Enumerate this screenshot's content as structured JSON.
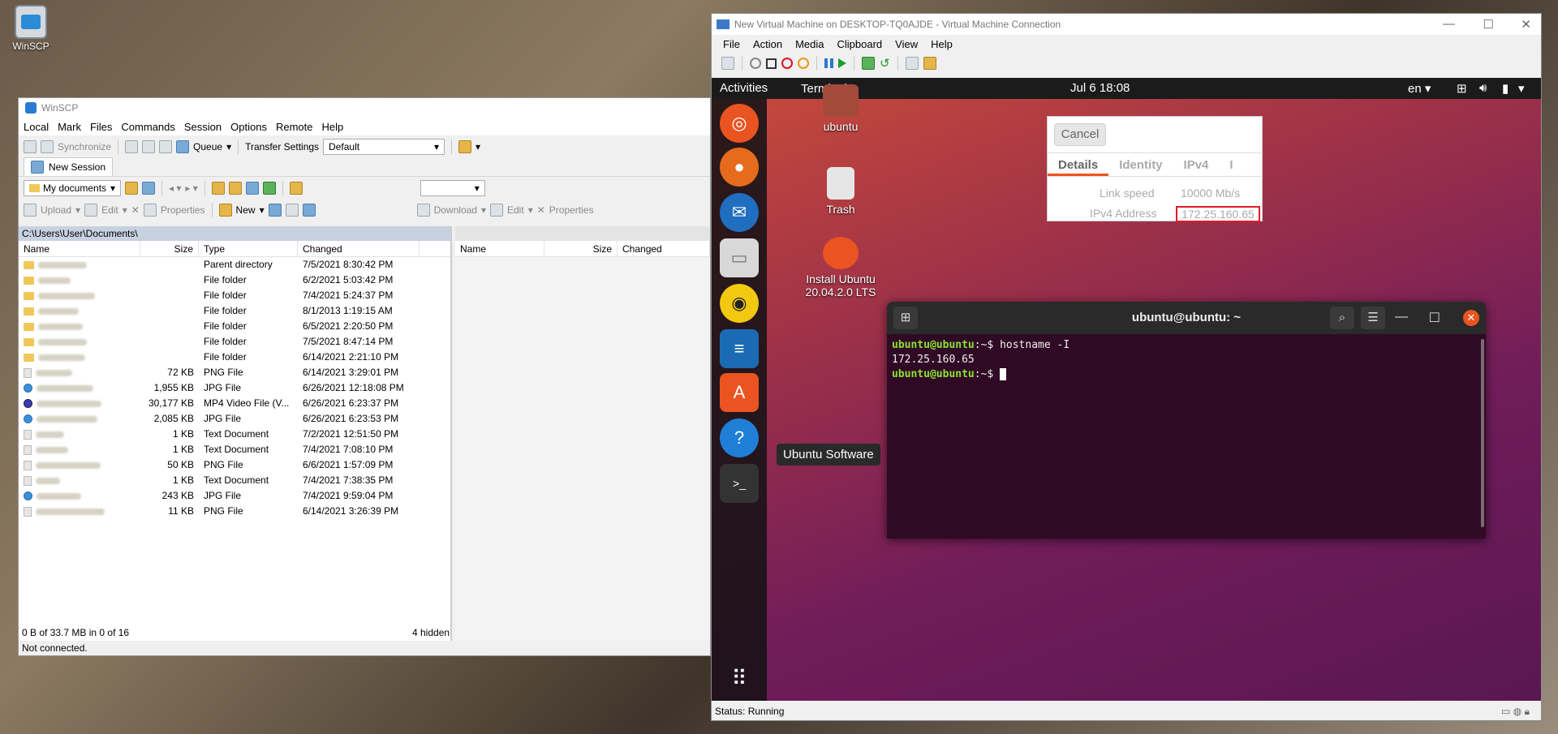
{
  "desktop": {
    "winscp_icon_label": "WinSCP"
  },
  "winscp": {
    "title": "WinSCP",
    "menu": [
      "Local",
      "Mark",
      "Files",
      "Commands",
      "Session",
      "Options",
      "Remote",
      "Help"
    ],
    "toolbar": {
      "synchronize": "Synchronize",
      "queue": "Queue",
      "transfer_settings": "Transfer Settings",
      "transfer_value": "Default"
    },
    "tab": "New Session",
    "left_location": "My documents",
    "left_actions": {
      "upload": "Upload",
      "edit": "Edit",
      "properties": "Properties",
      "new": "New"
    },
    "right_actions": {
      "download": "Download",
      "edit": "Edit",
      "properties": "Properties"
    },
    "left_path": "C:\\Users\\User\\Documents\\",
    "columns": {
      "name": "Name",
      "size": "Size",
      "type": "Type",
      "changed": "Changed"
    },
    "files": [
      {
        "size": "",
        "type": "Parent directory",
        "changed": "7/5/2021  8:30:42 PM",
        "icon": "folder"
      },
      {
        "size": "",
        "type": "File folder",
        "changed": "6/2/2021  5:03:42 PM",
        "icon": "folder"
      },
      {
        "size": "",
        "type": "File folder",
        "changed": "7/4/2021  5:24:37 PM",
        "icon": "folder"
      },
      {
        "size": "",
        "type": "File folder",
        "changed": "8/1/2013  1:19:15 AM",
        "icon": "folder"
      },
      {
        "size": "",
        "type": "File folder",
        "changed": "6/5/2021  2:20:50 PM",
        "icon": "folder"
      },
      {
        "size": "",
        "type": "File folder",
        "changed": "7/5/2021  8:47:14 PM",
        "icon": "folder"
      },
      {
        "size": "",
        "type": "File folder",
        "changed": "6/14/2021  2:21:10 PM",
        "icon": "folder"
      },
      {
        "size": "72 KB",
        "type": "PNG File",
        "changed": "6/14/2021  3:29:01 PM",
        "icon": "file"
      },
      {
        "size": "1,955 KB",
        "type": "JPG File",
        "changed": "6/26/2021  12:18:08 PM",
        "icon": "jpg"
      },
      {
        "size": "30,177 KB",
        "type": "MP4 Video File (V...",
        "changed": "6/26/2021  6:23:37 PM",
        "icon": "mp4"
      },
      {
        "size": "2,085 KB",
        "type": "JPG File",
        "changed": "6/26/2021  6:23:53 PM",
        "icon": "jpg"
      },
      {
        "size": "1 KB",
        "type": "Text Document",
        "changed": "7/2/2021  12:51:50 PM",
        "icon": "file"
      },
      {
        "size": "1 KB",
        "type": "Text Document",
        "changed": "7/4/2021  7:08:10 PM",
        "icon": "file"
      },
      {
        "size": "50 KB",
        "type": "PNG File",
        "changed": "6/6/2021  1:57:09 PM",
        "icon": "file"
      },
      {
        "size": "1 KB",
        "type": "Text Document",
        "changed": "7/4/2021  7:38:35 PM",
        "icon": "file"
      },
      {
        "size": "243 KB",
        "type": "JPG File",
        "changed": "7/4/2021  9:59:04 PM",
        "icon": "jpg"
      },
      {
        "size": "11 KB",
        "type": "PNG File",
        "changed": "6/14/2021  3:26:39 PM",
        "icon": "file"
      }
    ],
    "status_left": "0 B of 33.7 MB in 0 of 16",
    "status_hidden": "4 hidden",
    "connection": "Not connected."
  },
  "vm": {
    "title": "New Virtual Machine on DESKTOP-TQ0AJDE - Virtual Machine Connection",
    "menu": [
      "File",
      "Action",
      "Media",
      "Clipboard",
      "View",
      "Help"
    ],
    "status": "Status: Running"
  },
  "ubuntu": {
    "topbar": {
      "activities": "Activities",
      "app": "Terminal ▾",
      "clock": "Jul 6  18:08",
      "lang": "en ▾"
    },
    "desktop_icons": {
      "home": "ubuntu",
      "trash": "Trash",
      "install": "Install Ubuntu 20.04.2.0 LTS"
    },
    "dock_tooltip": "Ubuntu Software",
    "network": {
      "cancel": "Cancel",
      "tabs": [
        "Details",
        "Identity",
        "IPv4",
        "I"
      ],
      "link_speed_label": "Link speed",
      "link_speed": "10000 Mb/s",
      "ipv4_label": "IPv4 Address",
      "ipv4": "172.25.160.65"
    },
    "terminal": {
      "title": "ubuntu@ubuntu: ~",
      "prompt": "ubuntu@ubuntu",
      "path": ":~$ ",
      "command": "hostname -I",
      "output": "172.25.160.65"
    }
  }
}
